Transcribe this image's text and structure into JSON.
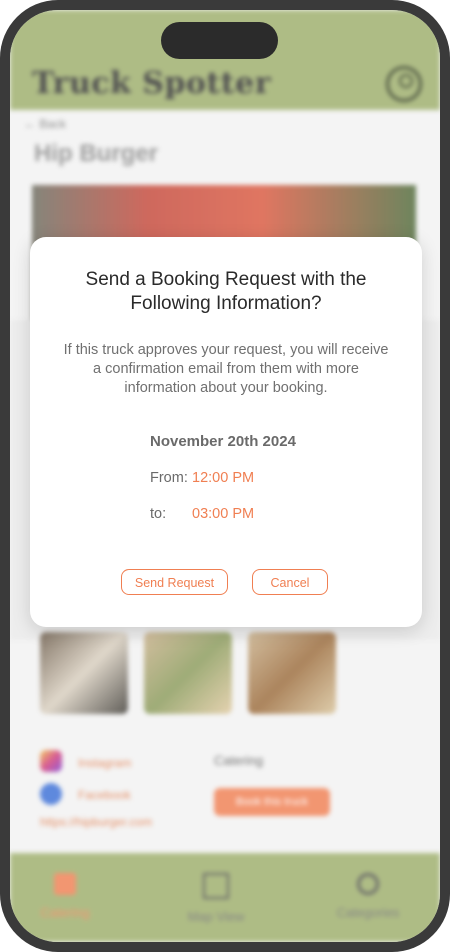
{
  "app": {
    "logo": "Truck Spotter",
    "back_label": "Back",
    "truck_name": "Hip Burger",
    "links": {
      "instagram": "Instagram",
      "facebook": "Facebook",
      "website": "https://hipburger.com"
    },
    "catering_label": "Catering",
    "book_button": "Book this truck"
  },
  "nav": {
    "items": [
      {
        "label": "Catering",
        "icon": "catering-icon",
        "active": true
      },
      {
        "label": "Map View",
        "icon": "map-icon",
        "active": false
      },
      {
        "label": "Categories",
        "icon": "search-icon",
        "active": false
      }
    ]
  },
  "modal": {
    "title": "Send a Booking Request with the Following Information?",
    "body": "If this truck approves your request, you will receive a confirmation email from them with more information about your booking.",
    "date": "November 20th 2024",
    "from_label": "From:",
    "from_value": "12:00 PM",
    "to_label": "to:",
    "to_value": "03:00 PM",
    "send_label": "Send Request",
    "cancel_label": "Cancel"
  },
  "colors": {
    "accent": "#f07f52",
    "header_green": "#9dae6b"
  }
}
